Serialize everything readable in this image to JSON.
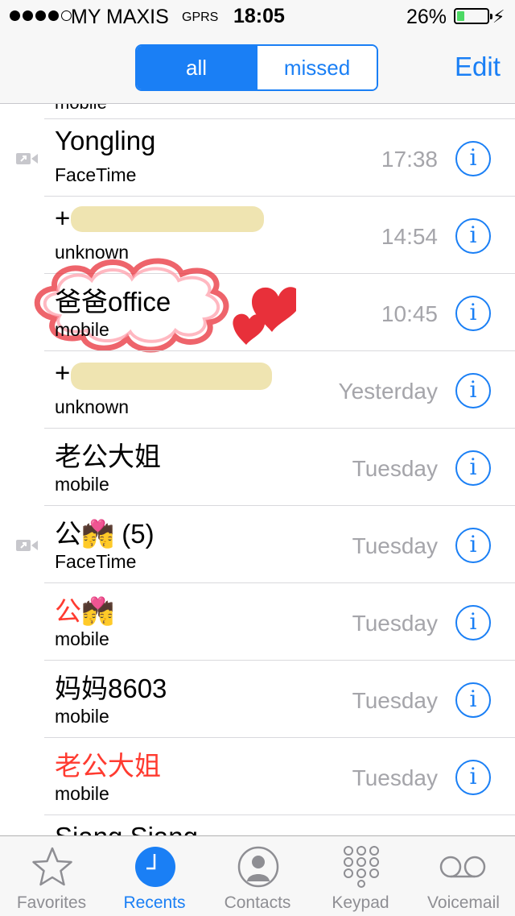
{
  "status": {
    "carrier": "MY MAXIS",
    "network": "GPRS",
    "time": "18:05",
    "battery_pct": "26%",
    "battery_level": 0.26
  },
  "nav": {
    "segments": [
      "all",
      "missed"
    ],
    "selected": "all",
    "edit": "Edit"
  },
  "list": {
    "cut_top_label": "mobile",
    "rows": [
      {
        "name": "Yongling",
        "type": "FaceTime",
        "when": "17:38",
        "facetime": true
      },
      {
        "name": "+",
        "type": "unknown",
        "when": "14:54"
      },
      {
        "name": "爸爸office",
        "type": "mobile",
        "when": "10:45"
      },
      {
        "name": "+",
        "type": "unknown",
        "when": "Yesterday"
      },
      {
        "name": "老公大姐",
        "type": "mobile",
        "when": "Tuesday"
      },
      {
        "name": "公💏 (5)",
        "type": "FaceTime",
        "when": "Tuesday",
        "facetime": true
      },
      {
        "name": "公💏",
        "type": "mobile",
        "when": "Tuesday",
        "missed": true
      },
      {
        "name": "妈妈8603",
        "type": "mobile",
        "when": "Tuesday"
      },
      {
        "name": "老公大姐",
        "type": "mobile",
        "when": "Tuesday",
        "missed": true
      },
      {
        "name": "Siang Siang",
        "type": "",
        "when": ""
      }
    ],
    "info_glyph": "i"
  },
  "tabs": [
    {
      "label": "Favorites",
      "icon": "star-icon"
    },
    {
      "label": "Recents",
      "icon": "clock-icon",
      "active": true
    },
    {
      "label": "Contacts",
      "icon": "contact-icon"
    },
    {
      "label": "Keypad",
      "icon": "keypad-icon"
    },
    {
      "label": "Voicemail",
      "icon": "voicemail-icon"
    }
  ],
  "colors": {
    "accent": "#1a7ff5",
    "missed": "#ff3b30",
    "doodle": "#e8303a"
  }
}
